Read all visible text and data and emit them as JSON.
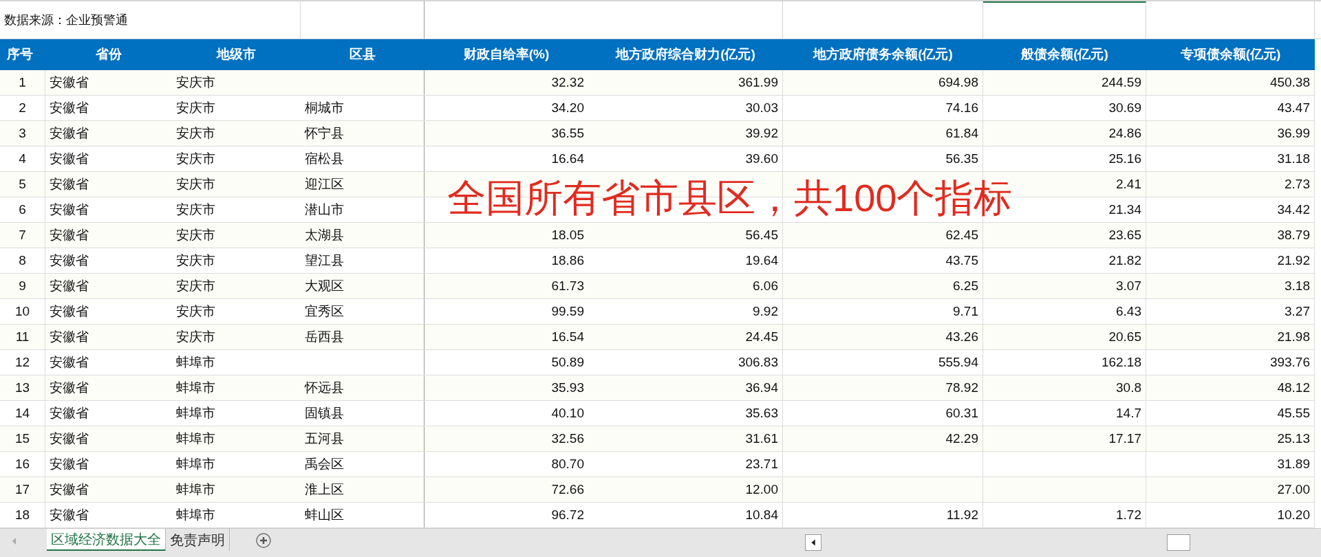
{
  "source_note": "数据来源：企业预警通",
  "table": {
    "columns": [
      "序号",
      "省份",
      "地级市",
      "区县",
      "财政自给率(%)",
      "地方政府综合财力(亿元)",
      "地方政府债务余额(亿元)",
      "般债余额(亿元)",
      "专项债余额(亿元)"
    ],
    "rows": [
      [
        "1",
        "安徽省",
        "安庆市",
        null,
        "32.32",
        "361.99",
        "694.98",
        "244.59",
        "450.38"
      ],
      [
        "2",
        "安徽省",
        "安庆市",
        "桐城市",
        "34.20",
        "30.03",
        "74.16",
        "30.69",
        "43.47"
      ],
      [
        "3",
        "安徽省",
        "安庆市",
        "怀宁县",
        "36.55",
        "39.92",
        "61.84",
        "24.86",
        "36.99"
      ],
      [
        "4",
        "安徽省",
        "安庆市",
        "宿松县",
        "16.64",
        "39.60",
        "56.35",
        "25.16",
        "31.18"
      ],
      [
        "5",
        "安徽省",
        "安庆市",
        "迎江区",
        null,
        null,
        null,
        "2.41",
        "2.73"
      ],
      [
        "6",
        "安徽省",
        "安庆市",
        "潜山市",
        null,
        null,
        null,
        "21.34",
        "34.42"
      ],
      [
        "7",
        "安徽省",
        "安庆市",
        "太湖县",
        "18.05",
        "56.45",
        "62.45",
        "23.65",
        "38.79"
      ],
      [
        "8",
        "安徽省",
        "安庆市",
        "望江县",
        "18.86",
        "19.64",
        "43.75",
        "21.82",
        "21.92"
      ],
      [
        "9",
        "安徽省",
        "安庆市",
        "大观区",
        "61.73",
        "6.06",
        "6.25",
        "3.07",
        "3.18"
      ],
      [
        "10",
        "安徽省",
        "安庆市",
        "宜秀区",
        "99.59",
        "9.92",
        "9.71",
        "6.43",
        "3.27"
      ],
      [
        "11",
        "安徽省",
        "安庆市",
        "岳西县",
        "16.54",
        "24.45",
        "43.26",
        "20.65",
        "21.98"
      ],
      [
        "12",
        "安徽省",
        "蚌埠市",
        null,
        "50.89",
        "306.83",
        "555.94",
        "162.18",
        "393.76"
      ],
      [
        "13",
        "安徽省",
        "蚌埠市",
        "怀远县",
        "35.93",
        "36.94",
        "78.92",
        "30.8",
        "48.12"
      ],
      [
        "14",
        "安徽省",
        "蚌埠市",
        "固镇县",
        "40.10",
        "35.63",
        "60.31",
        "14.7",
        "45.55"
      ],
      [
        "15",
        "安徽省",
        "蚌埠市",
        "五河县",
        "32.56",
        "31.61",
        "42.29",
        "17.17",
        "25.13"
      ],
      [
        "16",
        "安徽省",
        "蚌埠市",
        "禹会区",
        "80.70",
        "23.71",
        null,
        null,
        "31.89"
      ],
      [
        "17",
        "安徽省",
        "蚌埠市",
        "淮上区",
        "72.66",
        "12.00",
        null,
        null,
        "27.00"
      ],
      [
        "18",
        "安徽省",
        "蚌埠市",
        "蚌山区",
        "96.72",
        "10.84",
        "11.92",
        "1.72",
        "10.20"
      ]
    ]
  },
  "overlay_caption": "全国所有省市县区，共100个指标",
  "sheet_tabs": [
    {
      "label": "区域经济数据大全",
      "selected": true
    },
    {
      "label": "免责声明",
      "selected": false
    }
  ]
}
